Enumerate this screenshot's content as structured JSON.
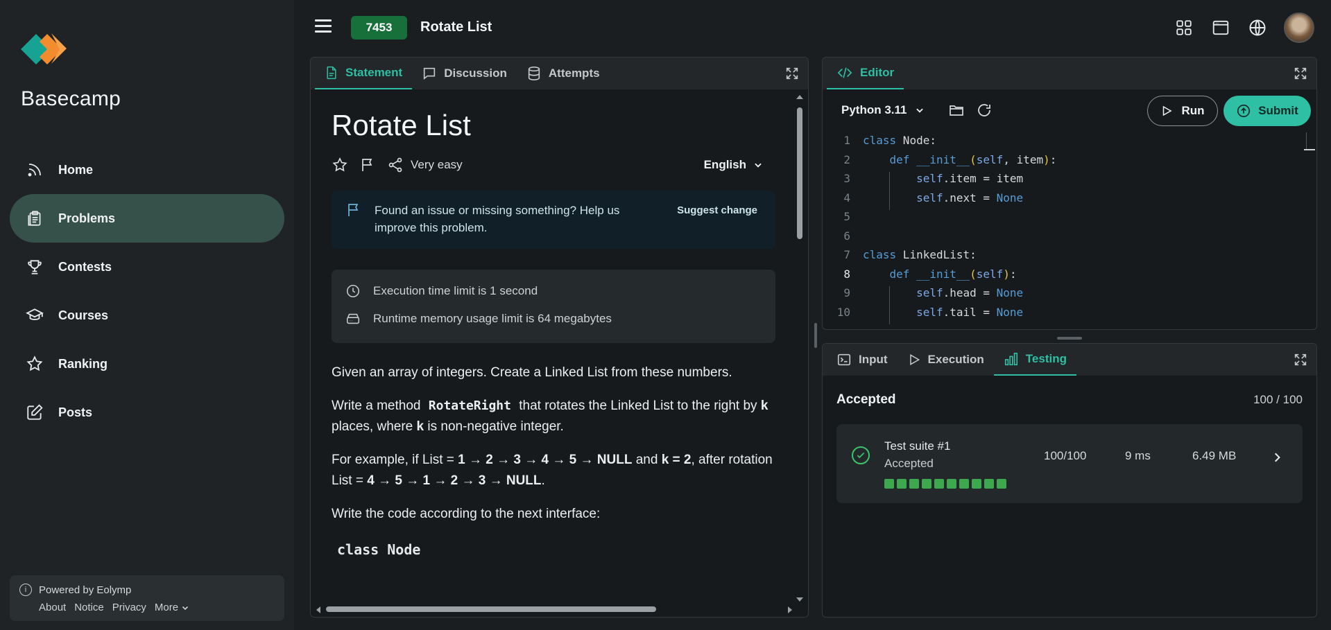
{
  "sidebar": {
    "brand": "Basecamp",
    "items": [
      {
        "label": "Home",
        "icon": "rss-icon"
      },
      {
        "label": "Problems",
        "icon": "clipboard-icon",
        "active": true
      },
      {
        "label": "Contests",
        "icon": "trophy-icon"
      },
      {
        "label": "Courses",
        "icon": "graduation-cap-icon"
      },
      {
        "label": "Ranking",
        "icon": "star-icon"
      },
      {
        "label": "Posts",
        "icon": "edit-icon"
      }
    ],
    "powered_by": "Powered by Eolymp",
    "footer_links": [
      "About",
      "Notice",
      "Privacy",
      "More"
    ]
  },
  "header": {
    "problem_id": "7453",
    "problem_title": "Rotate List"
  },
  "statement_panel": {
    "tabs": [
      "Statement",
      "Discussion",
      "Attempts"
    ],
    "title": "Rotate List",
    "difficulty": "Very easy",
    "language": "English",
    "issue_text": "Found an issue or missing something? Help us improve this problem.",
    "suggest_label": "Suggest change",
    "time_limit": "Execution time limit is 1 second",
    "memory_limit": "Runtime memory usage limit is 64 megabytes",
    "p1": "Given an array of integers. Create a Linked List from these numbers.",
    "p2_a": "Write a method ",
    "p2_code": "RotateRight",
    "p2_b": " that rotates the Linked List to the right by ",
    "p2_k1": "k",
    "p2_c": " places, where ",
    "p2_k2": "k",
    "p2_d": " is non-negative integer.",
    "p3_a": "For example, if List = ",
    "p3_list1": "1 → 2 → 3 → 4 → 5 → NULL",
    "p3_b": " and ",
    "p3_k": "k = 2",
    "p3_c": ", after rotation List = ",
    "p3_list2": "4 → 5 → 1 → 2 → 3 → NULL",
    "p3_d": ".",
    "p4": "Write the code according to the next interface:",
    "code_heading": "class Node"
  },
  "editor": {
    "tab": "Editor",
    "runtime": "Python 3.11",
    "run_label": "Run",
    "submit_label": "Submit",
    "current_line": 8
  },
  "results_panel": {
    "tabs": [
      "Input",
      "Execution",
      "Testing"
    ],
    "status": "Accepted",
    "score": "100 / 100",
    "suite": {
      "name": "Test suite #1",
      "status": "Accepted",
      "score": "100/100",
      "time": "9 ms",
      "memory": "6.49 MB",
      "tests_passed": 10
    }
  },
  "colors": {
    "accent": "#2fbfa4",
    "active_nav": "#36514a",
    "id_badge": "#17703a",
    "test_pass": "#3ea84f"
  }
}
